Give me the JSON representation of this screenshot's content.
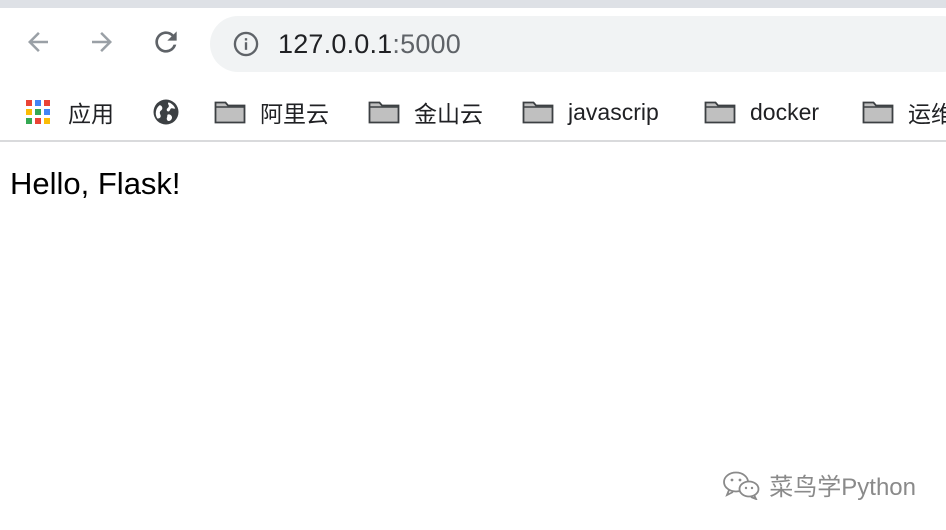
{
  "toolbar": {
    "back_icon": "arrow-left-icon",
    "forward_icon": "arrow-right-icon",
    "reload_icon": "reload-icon"
  },
  "address_bar": {
    "icon": "info-circle-icon",
    "host": "127.0.0.1",
    "port": ":5000"
  },
  "bookmarks": [
    {
      "label": "应用",
      "icon": "apps-grid-icon"
    },
    {
      "label": "",
      "icon": "globe-icon"
    },
    {
      "label": "阿里云",
      "icon": "folder-icon"
    },
    {
      "label": "金山云",
      "icon": "folder-icon"
    },
    {
      "label": "javascrip",
      "icon": "folder-icon"
    },
    {
      "label": "docker",
      "icon": "folder-icon"
    },
    {
      "label": "运维",
      "icon": "folder-icon"
    }
  ],
  "page": {
    "text": "Hello, Flask!"
  },
  "watermark": {
    "text": "菜鸟学Python",
    "icon": "wechat-icon"
  },
  "colors": {
    "toolbar_bg": "#ffffff",
    "omnibox_bg": "#f1f3f4",
    "icon_gray": "#5f6368",
    "disabled_gray": "#9aa0a6",
    "folder_fill": "#c0c0c0"
  }
}
